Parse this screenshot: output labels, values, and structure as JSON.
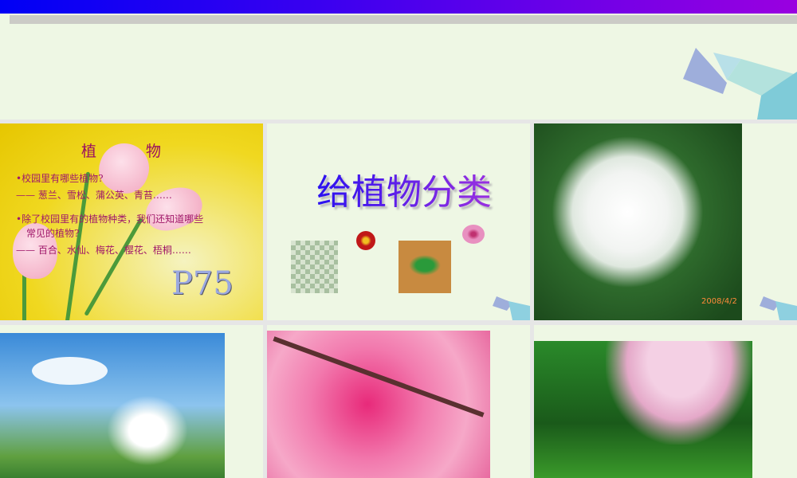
{
  "slides": [
    {
      "title": "植物",
      "q1": "•校园里有哪些植物?",
      "a1": "—— 葱兰、雪松、蒲公英、青苔……",
      "q2": "•除了校园里有的植物种类，我们还知道哪些",
      "q2b": "常见的植物?",
      "a2": "—— 百合、水仙、梅花、樱花、梧桐……",
      "page_ref": "P75"
    },
    {
      "title": "给植物分类"
    },
    {
      "photo": "white-azalea",
      "date_stamp": "2008/4/2"
    },
    {
      "photo": "daffodils-sky"
    },
    {
      "photo": "cherry-blossoms"
    },
    {
      "photo": "weeping-cherry-tree"
    }
  ],
  "colors": {
    "banner_start": "#0000f5",
    "banner_end": "#9a00e0",
    "slide_bg": "#eef7e4"
  }
}
